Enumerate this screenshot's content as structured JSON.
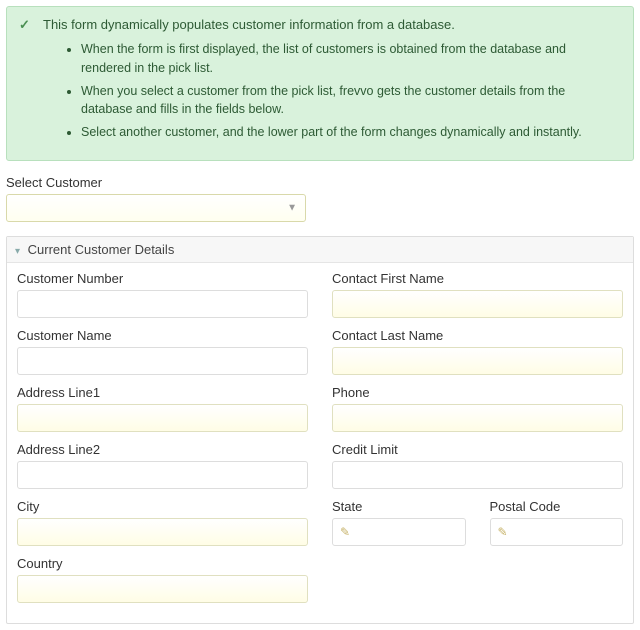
{
  "info": {
    "lead": "This form dynamically populates customer information from a database.",
    "bullets": [
      "When the form is first displayed, the list of customers is obtained from the database and rendered in the pick list.",
      "When you select a customer from the pick list, frevvo gets the customer details from the database and fills in the fields below.",
      "Select another customer, and the lower part of the form changes dynamically and instantly."
    ]
  },
  "selectCustomer": {
    "label": "Select Customer",
    "value": ""
  },
  "section": {
    "title": "Current Customer Details"
  },
  "fields": {
    "customerNumber": {
      "label": "Customer Number",
      "value": ""
    },
    "customerName": {
      "label": "Customer Name",
      "value": ""
    },
    "addressLine1": {
      "label": "Address Line1",
      "value": ""
    },
    "addressLine2": {
      "label": "Address Line2",
      "value": ""
    },
    "city": {
      "label": "City",
      "value": ""
    },
    "country": {
      "label": "Country",
      "value": ""
    },
    "contactFirstName": {
      "label": "Contact First Name",
      "value": ""
    },
    "contactLastName": {
      "label": "Contact Last Name",
      "value": ""
    },
    "phone": {
      "label": "Phone",
      "value": ""
    },
    "creditLimit": {
      "label": "Credit Limit",
      "value": ""
    },
    "state": {
      "label": "State",
      "value": ""
    },
    "postalCode": {
      "label": "Postal Code",
      "value": ""
    }
  }
}
